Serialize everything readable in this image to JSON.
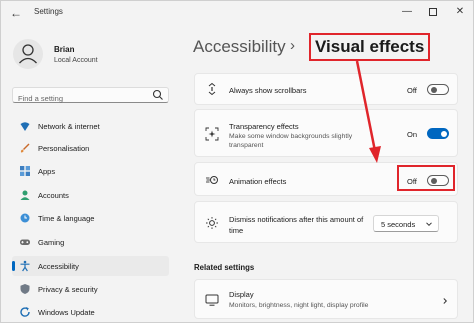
{
  "window": {
    "title": "Settings"
  },
  "profile": {
    "name": "Brian",
    "account": "Local Account"
  },
  "search": {
    "placeholder": "Find a setting"
  },
  "sidebar": {
    "items": [
      {
        "label": "Network & internet",
        "icon": "wifi-icon"
      },
      {
        "label": "Personalisation",
        "icon": "brush-icon"
      },
      {
        "label": "Apps",
        "icon": "apps-icon"
      },
      {
        "label": "Accounts",
        "icon": "person-icon"
      },
      {
        "label": "Time & language",
        "icon": "globe-clock-icon"
      },
      {
        "label": "Gaming",
        "icon": "gamepad-icon"
      },
      {
        "label": "Accessibility",
        "icon": "accessibility-icon",
        "active": true
      },
      {
        "label": "Privacy & security",
        "icon": "shield-icon"
      },
      {
        "label": "Windows Update",
        "icon": "update-icon"
      }
    ]
  },
  "breadcrumb": {
    "parent": "Accessibility",
    "separator": "›",
    "current": "Visual effects"
  },
  "settings": {
    "scrollbars": {
      "title": "Always show scrollbars",
      "state": "Off",
      "on": false
    },
    "transparency": {
      "title": "Transparency effects",
      "desc": "Make some window backgrounds slightly transparent",
      "state": "On",
      "on": true
    },
    "animation": {
      "title": "Animation effects",
      "state": "Off",
      "on": false
    },
    "notifications": {
      "title": "Dismiss notifications after this amount of time",
      "value": "5 seconds"
    }
  },
  "related": {
    "heading": "Related settings",
    "display": {
      "title": "Display",
      "desc": "Monitors, brightness, night light, display profile"
    }
  },
  "colors": {
    "accent": "#0067c0",
    "annotation": "#e0252b"
  }
}
